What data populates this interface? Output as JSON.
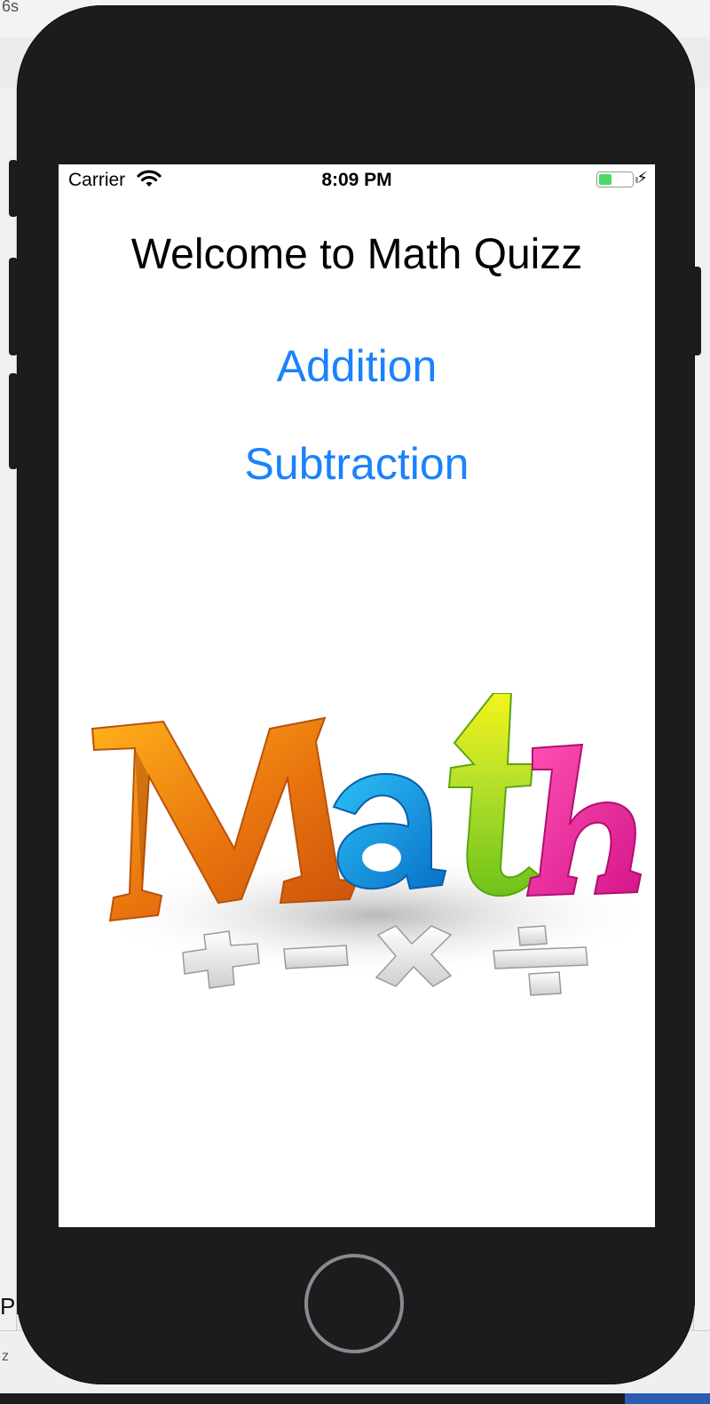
{
  "backdrop": {
    "top_left_text": "6s",
    "bottom_left_text": "Pl",
    "bottom_left_small": "z"
  },
  "status_bar": {
    "carrier": "Carrier",
    "time": "8:09 PM",
    "battery_level": 0.4,
    "charging": true,
    "wifi_icon": "wifi-icon",
    "bolt_icon": "charging-bolt-icon"
  },
  "main": {
    "title": "Welcome to Math Quizz",
    "buttons": [
      {
        "label": "Addition"
      },
      {
        "label": "Subtraction"
      }
    ],
    "image": {
      "letters": [
        "M",
        "a",
        "t",
        "h"
      ],
      "operators": [
        "+",
        "−",
        "×",
        "÷"
      ]
    }
  },
  "colors": {
    "accent": "#1a82fb",
    "device": "#1c1c1e",
    "battery_fill": "#4cd964"
  }
}
